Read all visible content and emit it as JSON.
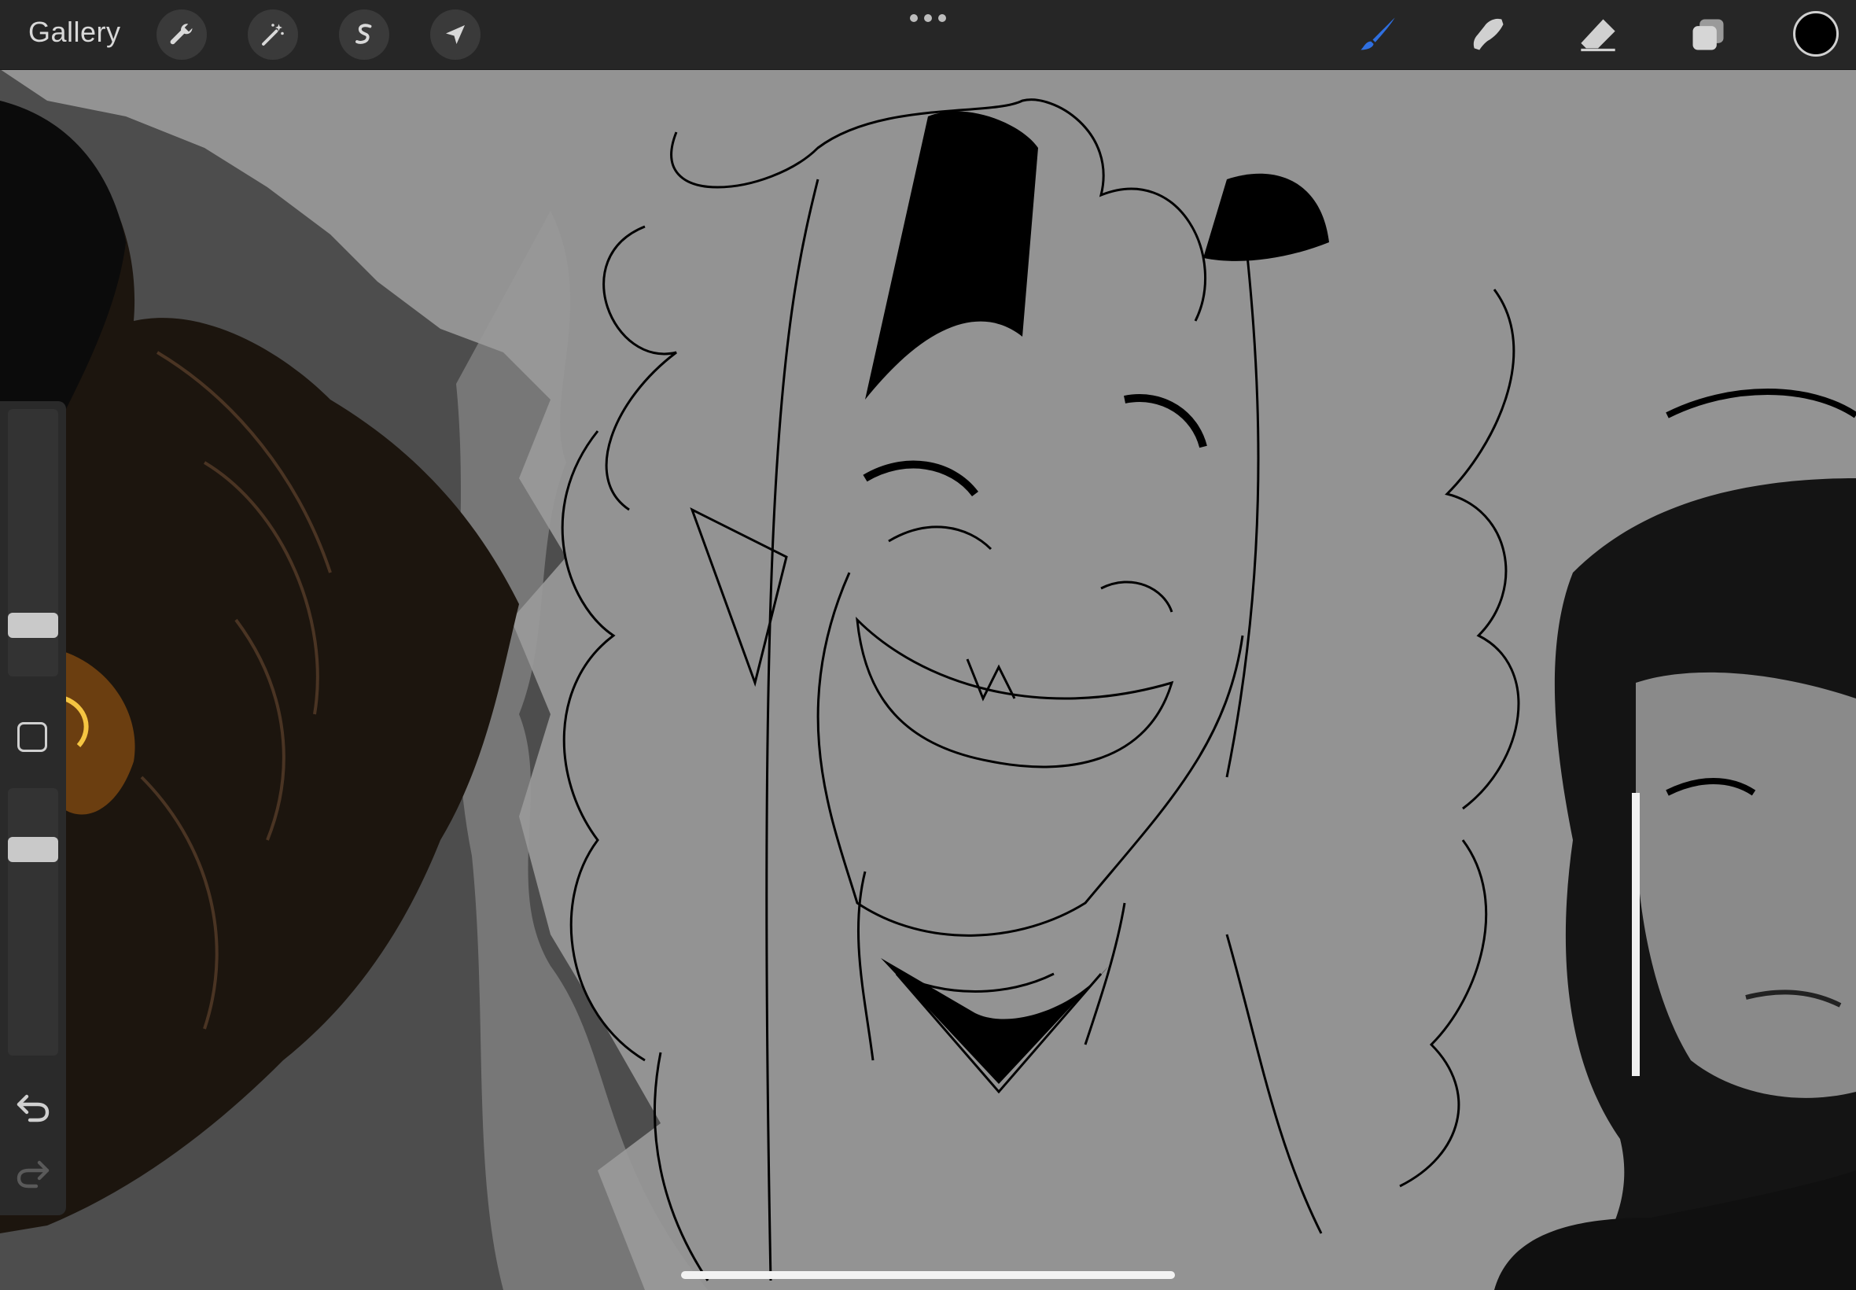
{
  "topbar": {
    "gallery_label": "Gallery",
    "left_tools": [
      {
        "name": "actions",
        "icon": "wrench-icon"
      },
      {
        "name": "adjustments",
        "icon": "magic-wand-icon"
      },
      {
        "name": "selection",
        "icon": "selection-s-icon"
      },
      {
        "name": "transform",
        "icon": "arrow-cursor-icon"
      }
    ],
    "more_icon": "ellipsis-icon",
    "right_tools": [
      {
        "name": "brush",
        "icon": "brush-icon",
        "active": true
      },
      {
        "name": "smudge",
        "icon": "smudge-finger-icon",
        "active": false
      },
      {
        "name": "eraser",
        "icon": "eraser-icon",
        "active": false
      },
      {
        "name": "layers",
        "icon": "layers-icon",
        "active": false
      }
    ],
    "current_color": "#000000",
    "accent_color": "#2f6fe0"
  },
  "sidebar": {
    "brush_size_level": 0.16,
    "opacity_level": 0.2,
    "modify_button_icon": "square-icon",
    "undo_icon": "undo-icon",
    "redo_icon": "redo-icon"
  },
  "canvas": {
    "background_color": "#939393"
  }
}
